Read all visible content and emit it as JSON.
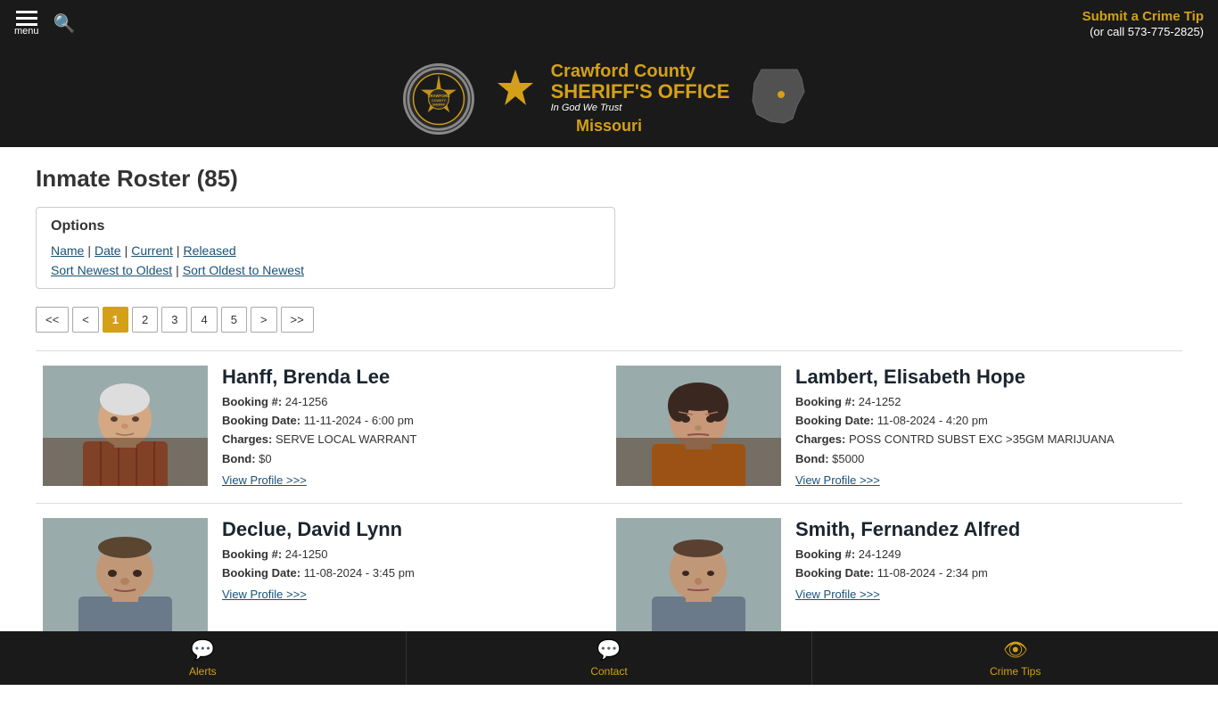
{
  "site": {
    "title": "Crawford County Sheriff's Office",
    "subtitle": "Missouri",
    "in_god": "In God We Trust",
    "crime_tip_label": "Submit a Crime Tip",
    "crime_tip_phone": "(or call 573-775-2825)"
  },
  "page": {
    "title": "Inmate Roster (85)"
  },
  "options": {
    "title": "Options",
    "links": {
      "name": "Name",
      "date": "Date",
      "current": "Current",
      "released": "Released"
    },
    "sort_newest": "Sort Newest to Oldest",
    "sort_oldest": "Sort Oldest to Newest"
  },
  "pagination": {
    "first": "<<",
    "prev": "<",
    "next": ">",
    "last": ">>",
    "pages": [
      "1",
      "2",
      "3",
      "4",
      "5"
    ],
    "active": "1"
  },
  "inmates": [
    {
      "id": "hanff",
      "name": "Hanff, Brenda Lee",
      "booking_num": "24-1256",
      "booking_date": "11-11-2024 - 6:00 pm",
      "charges": "SERVE LOCAL WARRANT",
      "bond": "$0",
      "view_profile": "View Profile >>>"
    },
    {
      "id": "lambert",
      "name": "Lambert, Elisabeth Hope",
      "booking_num": "24-1252",
      "booking_date": "11-08-2024 - 4:20 pm",
      "charges": "POSS CONTRD SUBST EXC >35GM MARIJUANA",
      "bond": "$5000",
      "view_profile": "View Profile >>>"
    },
    {
      "id": "declue",
      "name": "Declue, David Lynn",
      "booking_num": "24-1250",
      "booking_date": "11-08-2024 - 3:45 pm",
      "charges": "",
      "bond": "",
      "view_profile": "View Profile >>>"
    },
    {
      "id": "smith",
      "name": "Smith, Fernandez Alfred",
      "booking_num": "24-1249",
      "booking_date": "11-08-2024 - 2:34 pm",
      "charges": "",
      "bond": "",
      "view_profile": "View Profile >>>"
    }
  ],
  "bottom_nav": [
    {
      "id": "alerts",
      "label": "Alerts",
      "icon": "💬"
    },
    {
      "id": "contact",
      "label": "Contact",
      "icon": "💬"
    },
    {
      "id": "crime-tips",
      "label": "Crime Tips",
      "icon": "👁"
    }
  ],
  "labels": {
    "booking_num": "Booking #:",
    "booking_date": "Booking Date:",
    "charges": "Charges:",
    "bond": "Bond:"
  }
}
